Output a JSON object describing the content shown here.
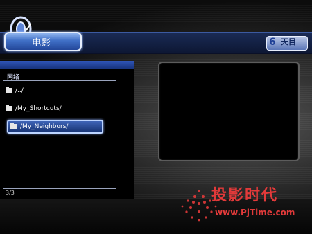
{
  "header": {
    "title": "电影",
    "brand": "天目",
    "brand_icon": "6"
  },
  "sidebar": {
    "section_label": "网络",
    "items": [
      {
        "label": "/../",
        "icon": "folder-icon"
      },
      {
        "label": "/My_Shortcuts/",
        "icon": "folder-icon"
      },
      {
        "label": "/My_Neighbors/",
        "icon": "folder-icon",
        "selected": true
      }
    ],
    "page_counter": "3/3"
  },
  "watermark": {
    "title": "投影时代",
    "url": "www.PjTime.com"
  },
  "colors": {
    "accent": "#2f55b8",
    "highlight": "#bcd4ff",
    "watermark": "#e23a3a"
  }
}
